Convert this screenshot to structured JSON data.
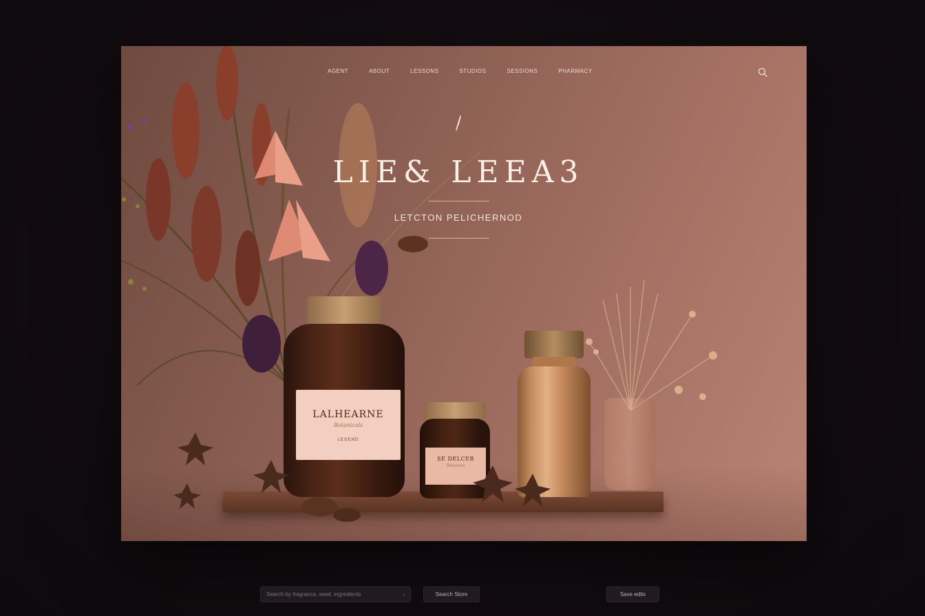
{
  "nav": {
    "items": [
      "AGENT",
      "ABOUT",
      "LESSONS",
      "STUDIOS",
      "SESSIONS",
      "PHARMACY"
    ]
  },
  "hero": {
    "title": "LIE& LEEA3",
    "subtitle": "LETCTON PELICHERNOD"
  },
  "products": {
    "big_jar": {
      "name": "LALHEARNE",
      "script": "Botanicals",
      "sub": "LEGEND"
    },
    "small_jar": {
      "name": "SE DELCEB",
      "script": "Botanica"
    }
  },
  "footer": {
    "input_placeholder": "Search by fragrance, seed, ingredients",
    "input_chevron": "›",
    "button1_label": "Search Store",
    "button2_label": "Save edits"
  },
  "colors": {
    "backdrop": "#120c10",
    "hero_start": "#6e4a3f",
    "hero_end": "#b98374",
    "title": "#fbeee6",
    "label": "#f2cfc0"
  },
  "icons": [
    "search-icon",
    "brand-mark-icon"
  ]
}
